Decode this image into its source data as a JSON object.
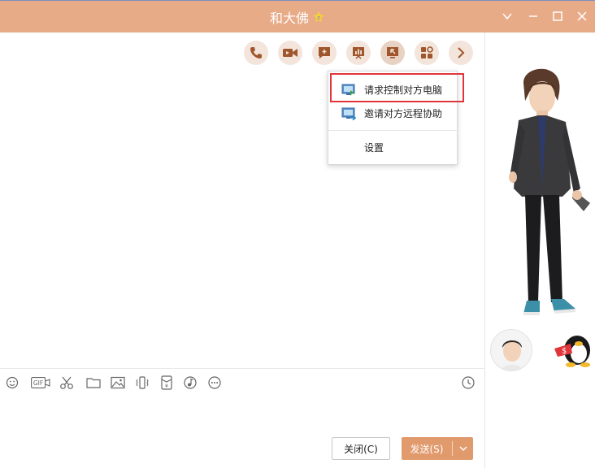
{
  "window": {
    "title": "和大佛",
    "controls": [
      "chevron-down-icon",
      "minimize-icon",
      "maximize-icon",
      "close-icon"
    ]
  },
  "toolbar": {
    "buttons": [
      {
        "name": "phone-call",
        "icon": "phone-icon"
      },
      {
        "name": "video-call",
        "icon": "video-camera-icon"
      },
      {
        "name": "add-message",
        "icon": "chat-plus-icon"
      },
      {
        "name": "presentation",
        "icon": "presentation-icon"
      },
      {
        "name": "remote-desktop",
        "icon": "remote-screen-icon",
        "active": true
      },
      {
        "name": "apps",
        "icon": "apps-grid-icon"
      },
      {
        "name": "more",
        "icon": "chevron-right-icon"
      }
    ]
  },
  "remote_menu": {
    "items": [
      {
        "label": "请求控制对方电脑",
        "icon": "request-control-icon",
        "highlighted": true
      },
      {
        "label": "邀请对方远程协助",
        "icon": "invite-assist-icon"
      },
      {
        "label": "设置"
      }
    ]
  },
  "input_tools": [
    "emoji-icon",
    "gif-icon",
    "scissors-icon",
    "folder-icon",
    "image-icon",
    "vibrate-icon",
    "red-packet-icon",
    "music-icon",
    "more-dots-icon",
    "history-clock-icon"
  ],
  "buttons": {
    "close_label": "关闭(C)",
    "send_label": "发送(S)"
  },
  "colors": {
    "titlebar": "#e8ab88",
    "accent": "#e19a6c",
    "icon": "#a0562c",
    "highlight_border": "#e0353b"
  }
}
